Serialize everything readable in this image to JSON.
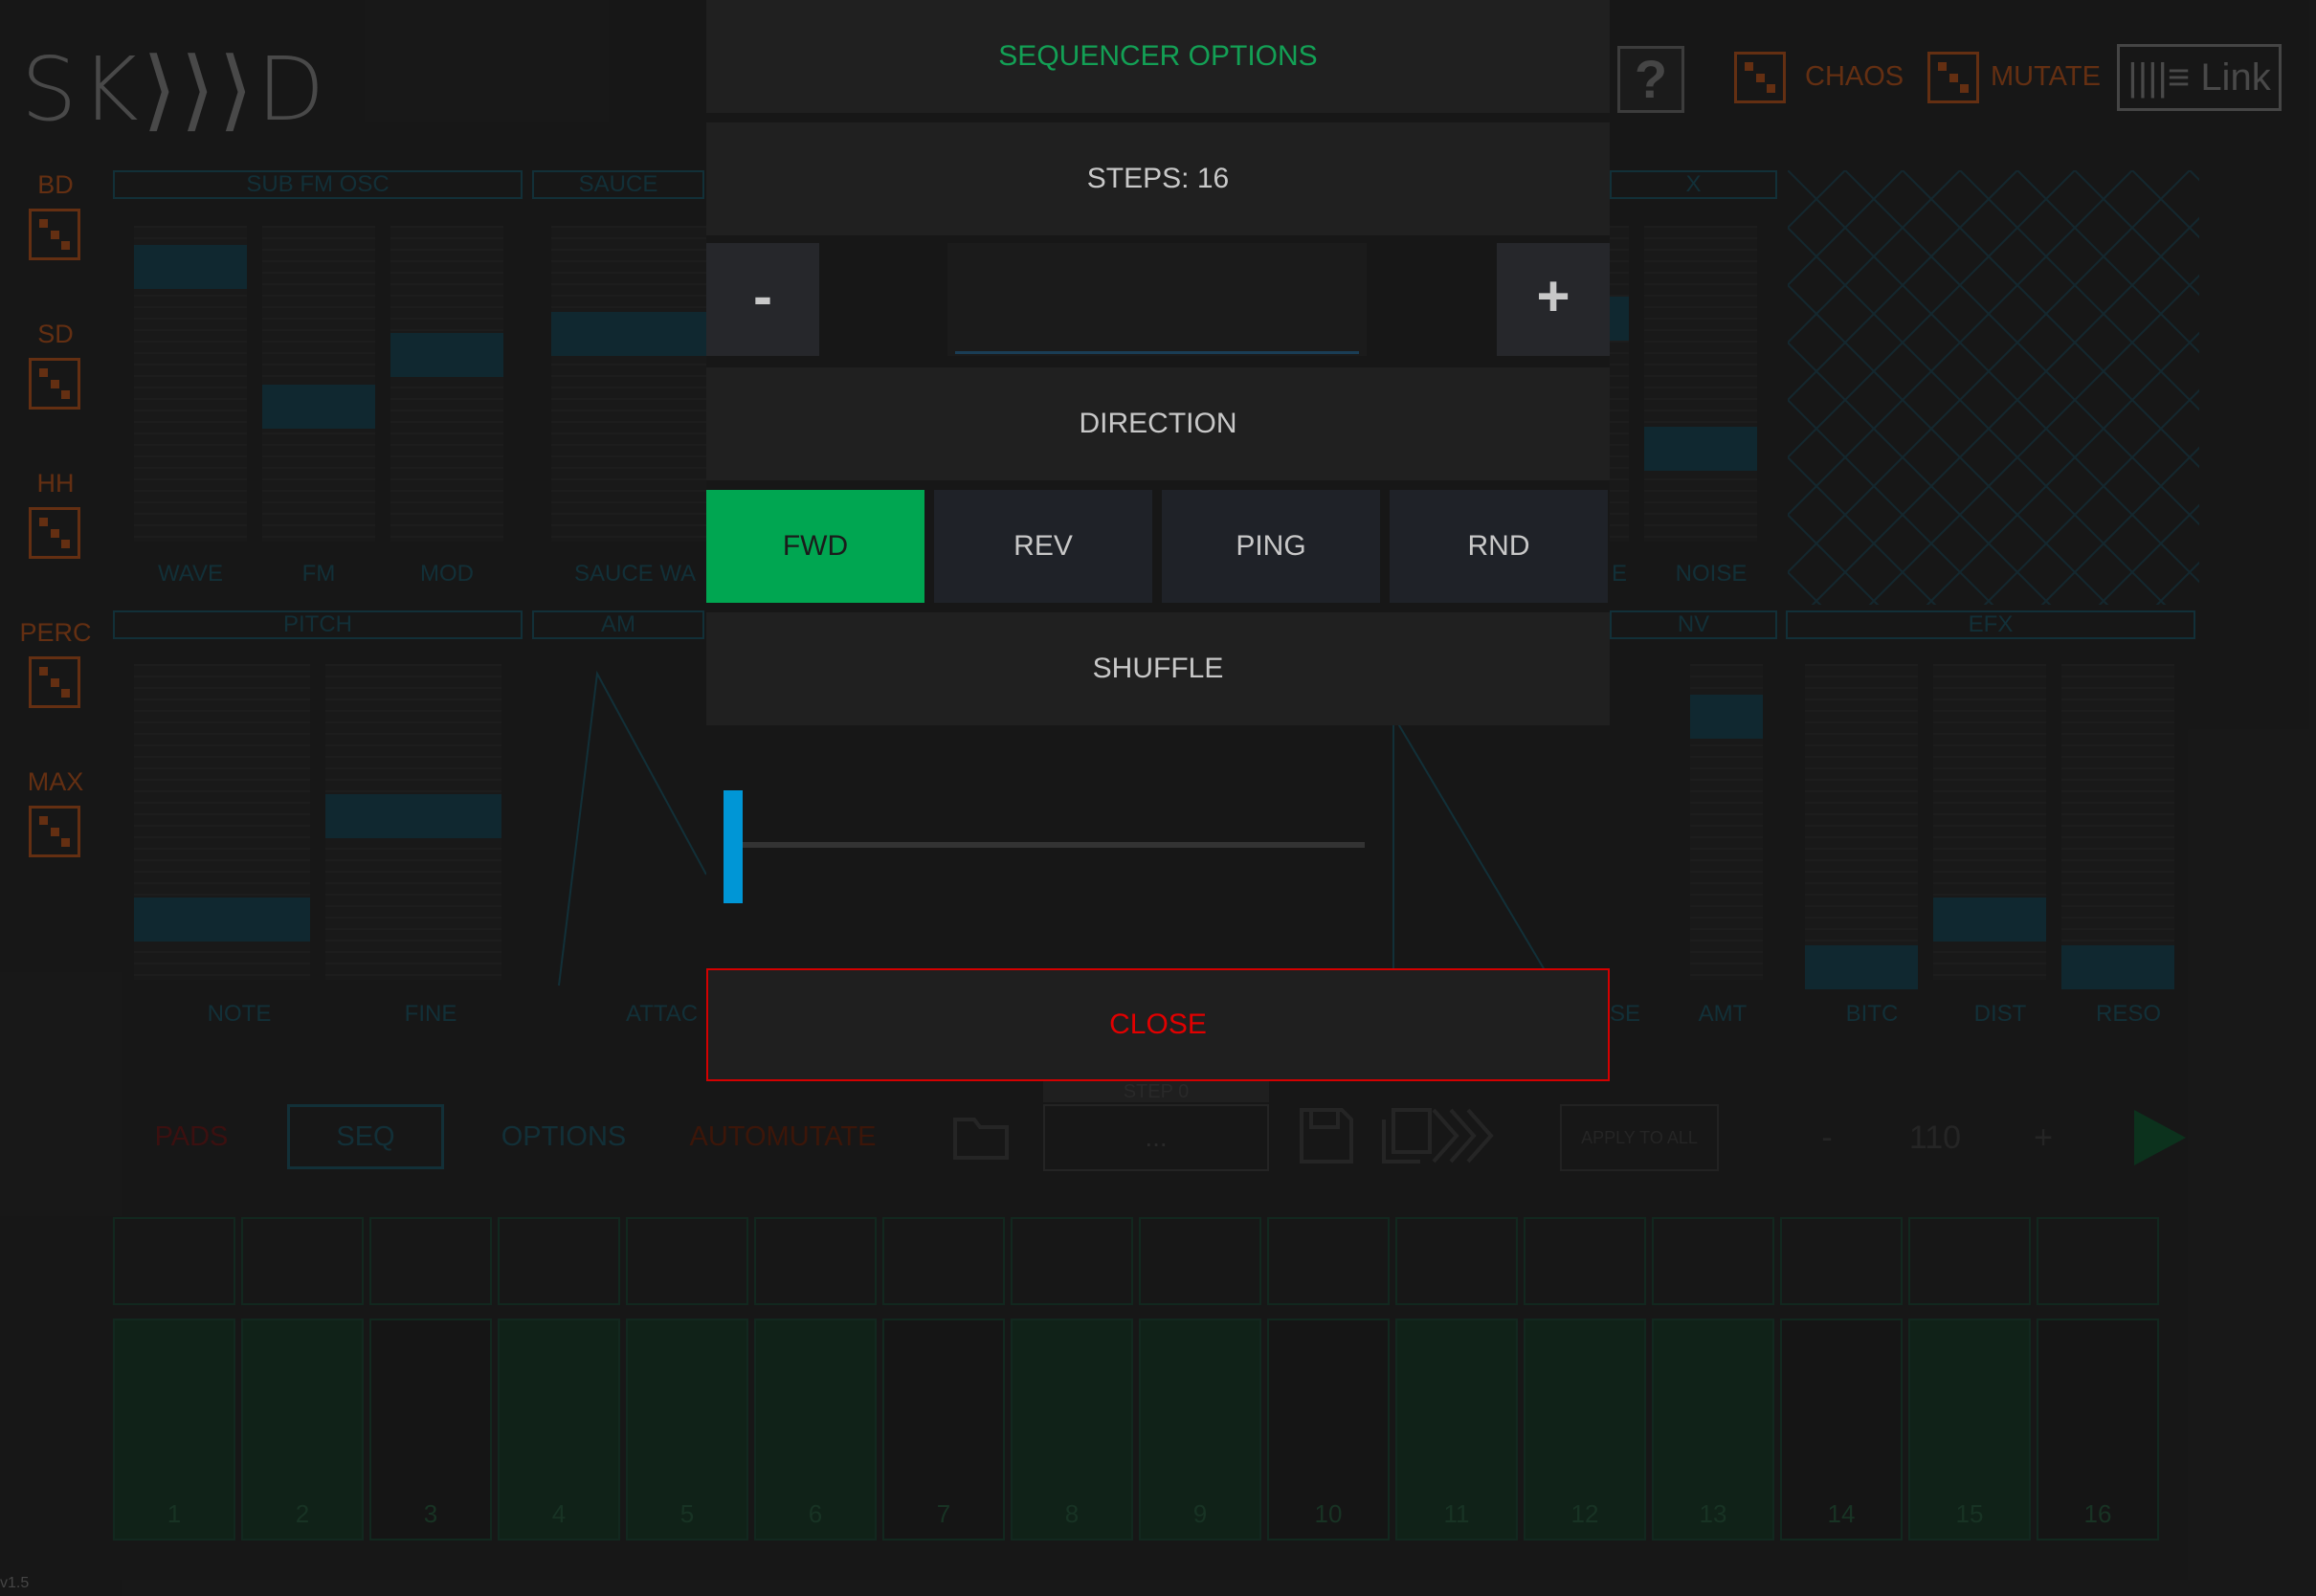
{
  "app": {
    "logo": "SK⟩⟩⟩D",
    "version": "v1.5",
    "header": {
      "help_symbol": "?",
      "chaos_label": "CHAOS",
      "mutate_label": "MUTATE",
      "link_label": "||||≡ Link"
    },
    "voices": [
      "BD",
      "SD",
      "HH",
      "PERC",
      "MAX"
    ],
    "panels": {
      "top": [
        {
          "title": "SUB FM OSC",
          "params": [
            "WAVE",
            "FM",
            "MOD"
          ],
          "levels": [
            0.9,
            0.5,
            0.62
          ]
        },
        {
          "title": "SAUCE",
          "params": [
            "SAUCE WA"
          ],
          "levels": [
            0.7
          ]
        },
        {
          "title": "X",
          "params": [
            "E",
            "NOISE"
          ],
          "levels": [
            0.72,
            0.3
          ]
        }
      ],
      "bottom": [
        {
          "title": "PITCH",
          "params": [
            "NOTE",
            "FINE"
          ],
          "levels": [
            0.2,
            0.55
          ]
        },
        {
          "title": "AM",
          "params": [
            "ATTAC"
          ]
        },
        {
          "title": "NV",
          "params": [
            "SE",
            "AMT"
          ],
          "levels": [
            0.85
          ]
        },
        {
          "title": "EFX",
          "params": [
            "BITC",
            "DIST",
            "RESO"
          ],
          "levels": [
            0.05,
            0.2,
            0.05
          ]
        }
      ]
    },
    "bottom_bar": {
      "tabs": [
        "PADS",
        "SEQ",
        "OPTIONS",
        "AUTOMUTATE"
      ],
      "preset_label": "STEP 0",
      "preset_value": "...",
      "record_label": "APPLY TO ALL",
      "tempo_minus": "-",
      "tempo_value": "110",
      "tempo_plus": "+"
    },
    "steps": [
      {
        "n": "1",
        "on": true
      },
      {
        "n": "2",
        "on": true
      },
      {
        "n": "3",
        "on": false
      },
      {
        "n": "4",
        "on": true
      },
      {
        "n": "5",
        "on": true
      },
      {
        "n": "6",
        "on": true
      },
      {
        "n": "7",
        "on": false
      },
      {
        "n": "8",
        "on": true
      },
      {
        "n": "9",
        "on": true
      },
      {
        "n": "10",
        "on": false
      },
      {
        "n": "11",
        "on": true
      },
      {
        "n": "12",
        "on": true
      },
      {
        "n": "13",
        "on": true
      },
      {
        "n": "14",
        "on": false
      },
      {
        "n": "15",
        "on": true
      },
      {
        "n": "16",
        "on": false
      }
    ]
  },
  "dialog": {
    "title": "SEQUENCER OPTIONS",
    "steps_label": "STEPS: 16",
    "steps_value": 16,
    "minus_label": "-",
    "plus_label": "+",
    "direction_label": "DIRECTION",
    "directions": [
      "FWD",
      "REV",
      "PING",
      "RND"
    ],
    "selected_direction": "FWD",
    "shuffle_label": "SHUFFLE",
    "shuffle_value": 0,
    "close_label": "CLOSE",
    "accent_color": "#00a651",
    "close_color": "#e10000"
  }
}
